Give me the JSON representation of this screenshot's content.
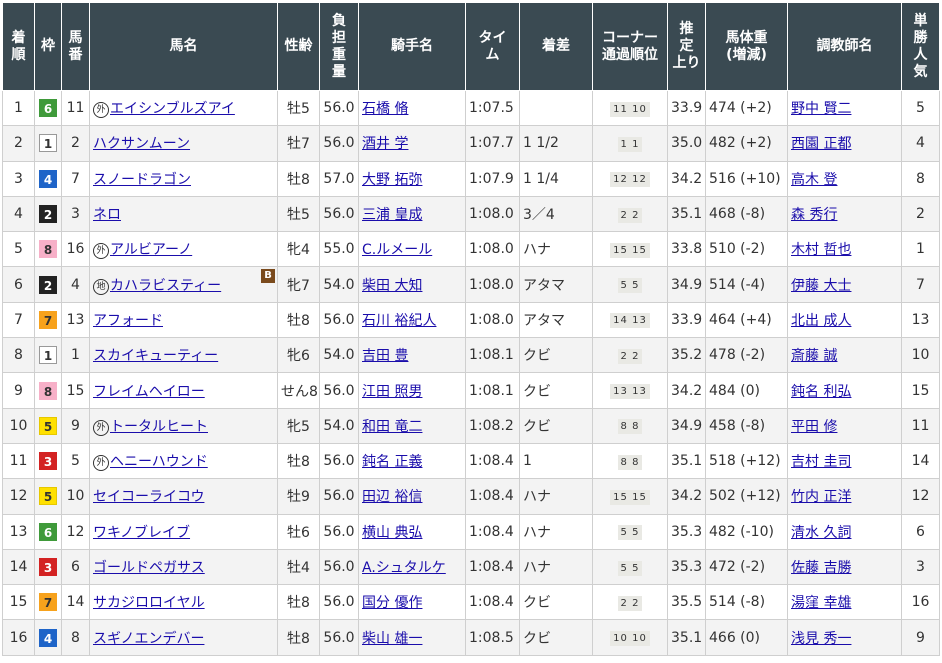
{
  "headers": {
    "rank": "着\n順",
    "waku": "枠",
    "num": "馬\n番",
    "horse": "馬名",
    "sex": "性齢",
    "weight": "負\n担\n重\n量",
    "jockey": "騎手名",
    "time": "タイ\nム",
    "margin": "着差",
    "corner": "コーナー\n通過順位",
    "up": "推\n定\n上り",
    "body": "馬体重\n(増減)",
    "trainer": "調教師名",
    "pop": "単\n勝\n人\n気"
  },
  "waku_colors": {
    "1": {
      "bg": "#ffffff",
      "fg": "#333333",
      "border": "#999999"
    },
    "2": {
      "bg": "#222222",
      "fg": "#ffffff",
      "border": "#222222"
    },
    "3": {
      "bg": "#d32222",
      "fg": "#ffffff",
      "border": "#d32222"
    },
    "4": {
      "bg": "#1e64c8",
      "fg": "#ffffff",
      "border": "#1e64c8"
    },
    "5": {
      "bg": "#ffe000",
      "fg": "#333333",
      "border": "#e6c800"
    },
    "6": {
      "bg": "#3f9a3a",
      "fg": "#ffffff",
      "border": "#3f9a3a"
    },
    "7": {
      "bg": "#f7a21c",
      "fg": "#333333",
      "border": "#f7a21c"
    },
    "8": {
      "bg": "#f7b0c8",
      "fg": "#333333",
      "border": "#f7b0c8"
    }
  },
  "rows": [
    {
      "rank": "1",
      "waku": "6",
      "num": "11",
      "mark": "外",
      "horse": "エイシンブルズアイ",
      "blinker": "",
      "sex": "牡5",
      "weight": "56.0",
      "jockey": "石橋 脩",
      "time": "1:07.5",
      "margin": "",
      "corner": "11 10",
      "up": "33.9",
      "body": "474 (+2)",
      "trainer": "野中 賢二",
      "pop": "5"
    },
    {
      "rank": "2",
      "waku": "1",
      "num": "2",
      "mark": "",
      "horse": "ハクサンムーン",
      "blinker": "",
      "sex": "牡7",
      "weight": "56.0",
      "jockey": "酒井 学",
      "time": "1:07.7",
      "margin": "1 1/2",
      "corner": "1 1",
      "up": "35.0",
      "body": "482 (+2)",
      "trainer": "西園 正都",
      "pop": "4"
    },
    {
      "rank": "3",
      "waku": "4",
      "num": "7",
      "mark": "",
      "horse": "スノードラゴン",
      "blinker": "",
      "sex": "牡8",
      "weight": "57.0",
      "jockey": "大野 拓弥",
      "time": "1:07.9",
      "margin": "1 1/4",
      "corner": "12 12",
      "up": "34.2",
      "body": "516 (+10)",
      "trainer": "高木 登",
      "pop": "8"
    },
    {
      "rank": "4",
      "waku": "2",
      "num": "3",
      "mark": "",
      "horse": "ネロ",
      "blinker": "",
      "sex": "牡5",
      "weight": "56.0",
      "jockey": "三浦 皇成",
      "time": "1:08.0",
      "margin": "3／4",
      "corner": "2 2",
      "up": "35.1",
      "body": "468 (-8)",
      "trainer": "森 秀行",
      "pop": "2"
    },
    {
      "rank": "5",
      "waku": "8",
      "num": "16",
      "mark": "外",
      "horse": "アルビアーノ",
      "blinker": "",
      "sex": "牝4",
      "weight": "55.0",
      "jockey": "C.ルメール",
      "time": "1:08.0",
      "margin": "ハナ",
      "corner": "15 15",
      "up": "33.8",
      "body": "510 (-2)",
      "trainer": "木村 哲也",
      "pop": "1"
    },
    {
      "rank": "6",
      "waku": "2",
      "num": "4",
      "mark": "地",
      "horse": "カハラビスティー",
      "blinker": "B",
      "sex": "牝7",
      "weight": "54.0",
      "jockey": "柴田 大知",
      "time": "1:08.0",
      "margin": "アタマ",
      "corner": "5 5",
      "up": "34.9",
      "body": "514 (-4)",
      "trainer": "伊藤 大士",
      "pop": "7"
    },
    {
      "rank": "7",
      "waku": "7",
      "num": "13",
      "mark": "",
      "horse": "アフォード",
      "blinker": "",
      "sex": "牡8",
      "weight": "56.0",
      "jockey": "石川 裕紀人",
      "time": "1:08.0",
      "margin": "アタマ",
      "corner": "14 13",
      "up": "33.9",
      "body": "464 (+4)",
      "trainer": "北出 成人",
      "pop": "13"
    },
    {
      "rank": "8",
      "waku": "1",
      "num": "1",
      "mark": "",
      "horse": "スカイキューティー",
      "blinker": "",
      "sex": "牝6",
      "weight": "54.0",
      "jockey": "吉田 豊",
      "time": "1:08.1",
      "margin": "クビ",
      "corner": "2 2",
      "up": "35.2",
      "body": "478 (-2)",
      "trainer": "斎藤 誠",
      "pop": "10"
    },
    {
      "rank": "9",
      "waku": "8",
      "num": "15",
      "mark": "",
      "horse": "フレイムヘイロー",
      "blinker": "",
      "sex": "せん8",
      "weight": "56.0",
      "jockey": "江田 照男",
      "time": "1:08.1",
      "margin": "クビ",
      "corner": "13 13",
      "up": "34.2",
      "body": "484 (0)",
      "trainer": "鈍名 利弘",
      "pop": "15"
    },
    {
      "rank": "10",
      "waku": "5",
      "num": "9",
      "mark": "外",
      "horse": "トータルヒート",
      "blinker": "",
      "sex": "牝5",
      "weight": "54.0",
      "jockey": "和田 竜二",
      "time": "1:08.2",
      "margin": "クビ",
      "corner": "8 8",
      "up": "34.9",
      "body": "458 (-8)",
      "trainer": "平田 修",
      "pop": "11"
    },
    {
      "rank": "11",
      "waku": "3",
      "num": "5",
      "mark": "外",
      "horse": "ヘニーハウンド",
      "blinker": "",
      "sex": "牡8",
      "weight": "56.0",
      "jockey": "鈍名 正義",
      "time": "1:08.4",
      "margin": "1",
      "corner": "8 8",
      "up": "35.1",
      "body": "518 (+12)",
      "trainer": "吉村 圭司",
      "pop": "14"
    },
    {
      "rank": "12",
      "waku": "5",
      "num": "10",
      "mark": "",
      "horse": "セイコーライコウ",
      "blinker": "",
      "sex": "牡9",
      "weight": "56.0",
      "jockey": "田辺 裕信",
      "time": "1:08.4",
      "margin": "ハナ",
      "corner": "15 15",
      "up": "34.2",
      "body": "502 (+12)",
      "trainer": "竹内 正洋",
      "pop": "12"
    },
    {
      "rank": "13",
      "waku": "6",
      "num": "12",
      "mark": "",
      "horse": "ワキノブレイブ",
      "blinker": "",
      "sex": "牡6",
      "weight": "56.0",
      "jockey": "横山 典弘",
      "time": "1:08.4",
      "margin": "ハナ",
      "corner": "5 5",
      "up": "35.3",
      "body": "482 (-10)",
      "trainer": "清水 久詞",
      "pop": "6"
    },
    {
      "rank": "14",
      "waku": "3",
      "num": "6",
      "mark": "",
      "horse": "ゴールドペガサス",
      "blinker": "",
      "sex": "牡4",
      "weight": "56.0",
      "jockey": "A.シュタルケ",
      "time": "1:08.4",
      "margin": "ハナ",
      "corner": "5 5",
      "up": "35.3",
      "body": "472 (-2)",
      "trainer": "佐藤 吉勝",
      "pop": "3"
    },
    {
      "rank": "15",
      "waku": "7",
      "num": "14",
      "mark": "",
      "horse": "サカジロロイヤル",
      "blinker": "",
      "sex": "牡8",
      "weight": "56.0",
      "jockey": "国分 優作",
      "time": "1:08.4",
      "margin": "クビ",
      "corner": "2 2",
      "up": "35.5",
      "body": "514 (-8)",
      "trainer": "湯窪 幸雄",
      "pop": "16"
    },
    {
      "rank": "16",
      "waku": "4",
      "num": "8",
      "mark": "",
      "horse": "スギノエンデバー",
      "blinker": "",
      "sex": "牡8",
      "weight": "56.0",
      "jockey": "柴山 雄一",
      "time": "1:08.5",
      "margin": "クビ",
      "corner": "10 10",
      "up": "35.1",
      "body": "466 (0)",
      "trainer": "浅見 秀一",
      "pop": "9"
    }
  ]
}
